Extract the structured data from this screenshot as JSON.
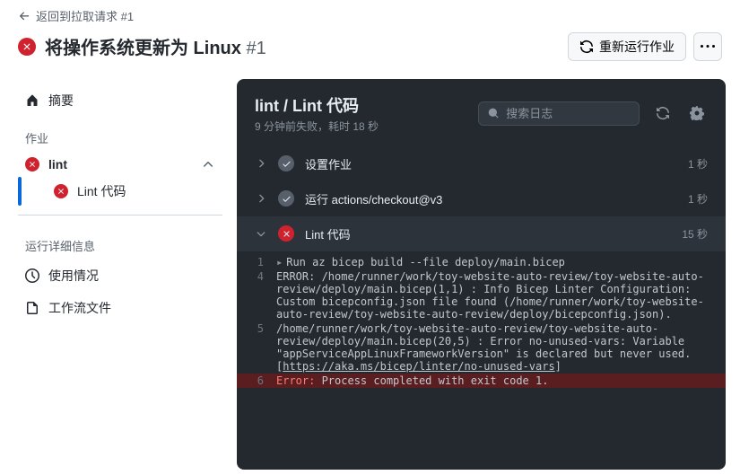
{
  "back_link": "返回到拉取请求 #1",
  "title": "将操作系统更新为 Linux",
  "title_num": "#1",
  "rerun_label": "重新运行作业",
  "sidebar": {
    "summary": "摘要",
    "jobs_header": "作业",
    "job_name": "lint",
    "step_name": "Lint 代码",
    "details_header": "运行详细信息",
    "usage": "使用情况",
    "workflow_file": "工作流文件"
  },
  "panel": {
    "title": "lint / Lint 代码",
    "subtitle": "9 分钟前失败，耗时 18 秒",
    "search_placeholder": "搜索日志"
  },
  "steps": [
    {
      "label": "设置作业",
      "time": "1 秒",
      "status": "ok",
      "expanded": false
    },
    {
      "label": "运行 actions/checkout@v3",
      "time": "1 秒",
      "status": "ok",
      "expanded": false
    },
    {
      "label": "Lint 代码",
      "time": "15 秒",
      "status": "fail",
      "expanded": true
    }
  ],
  "log": {
    "lines": [
      {
        "n": "1",
        "cls": "",
        "caret": true,
        "text": "Run az bicep build --file deploy/main.bicep"
      },
      {
        "n": "4",
        "cls": "",
        "text": "ERROR: /home/runner/work/toy-website-auto-review/toy-website-auto-review/deploy/main.bicep(1,1) : Info Bicep Linter Configuration: Custom bicepconfig.json file found (/home/runner/work/toy-website-auto-review/toy-website-auto-review/deploy/bicepconfig.json)."
      },
      {
        "n": "5",
        "cls": "",
        "text": "/home/runner/work/toy-website-auto-review/toy-website-auto-review/deploy/main.bicep(20,5) : Error no-unused-vars: Variable \"appServiceAppLinuxFrameworkVersion\" is declared but never used. [",
        "link": "https://aka.ms/bicep/linter/no-unused-vars",
        "after": "]"
      },
      {
        "n": "6",
        "cls": "err",
        "ekw": "Error:",
        "text": " Process completed with exit code 1."
      }
    ]
  }
}
